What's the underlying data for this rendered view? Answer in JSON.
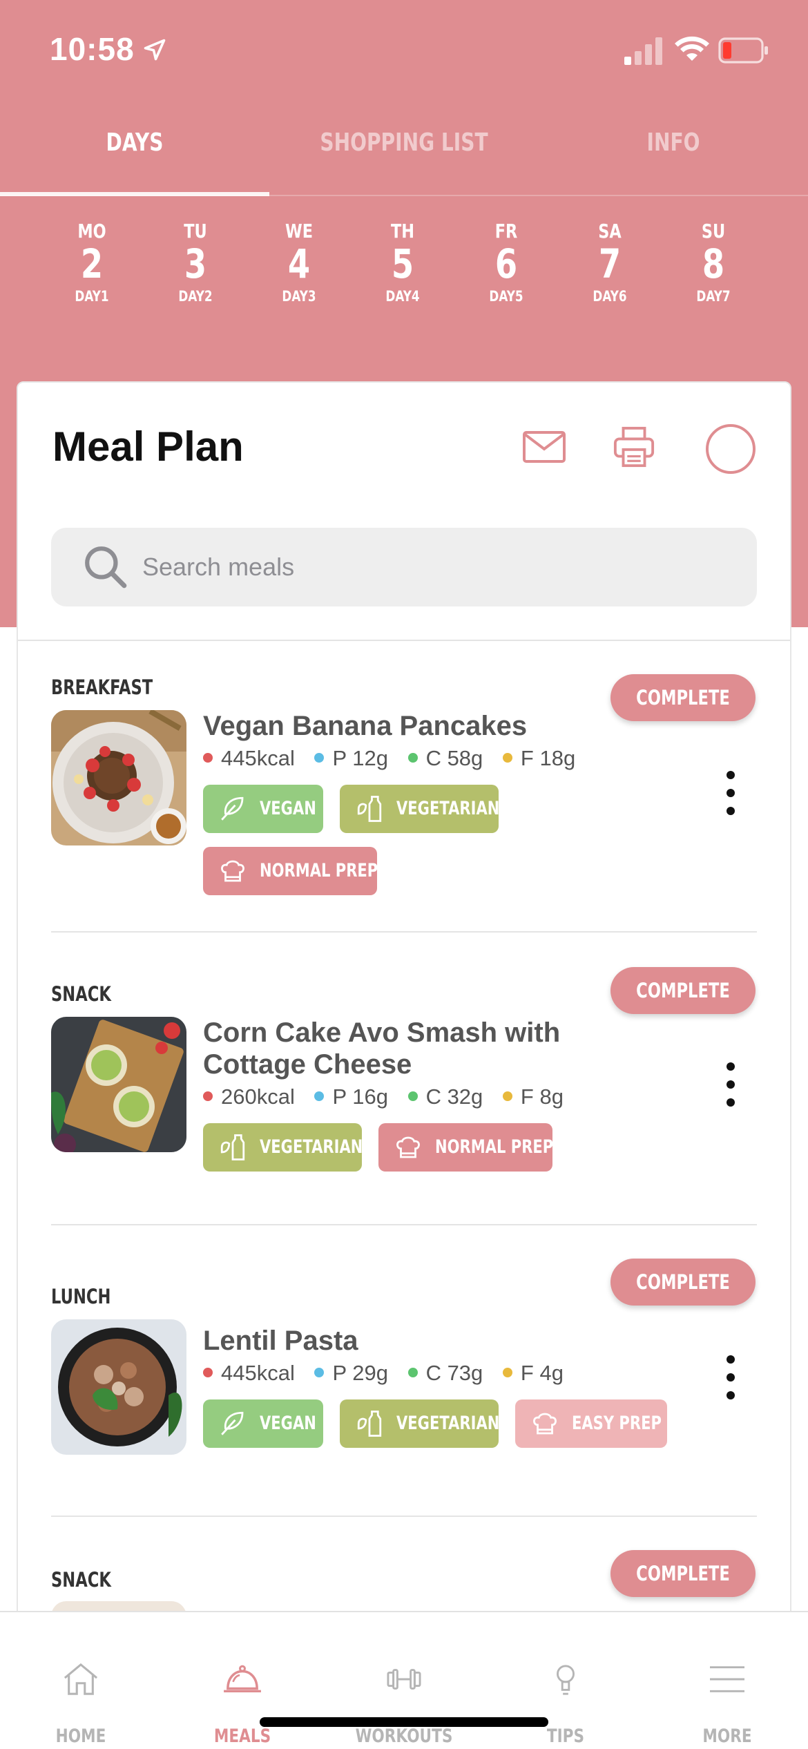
{
  "status_bar": {
    "time": "10:58"
  },
  "tabs": [
    {
      "label": "DAYS",
      "active": true
    },
    {
      "label": "SHOPPING LIST",
      "active": false
    },
    {
      "label": "INFO",
      "active": false
    }
  ],
  "days": [
    {
      "name": "MO",
      "num": "2",
      "label": "DAY1"
    },
    {
      "name": "TU",
      "num": "3",
      "label": "DAY2"
    },
    {
      "name": "WE",
      "num": "4",
      "label": "DAY3"
    },
    {
      "name": "TH",
      "num": "5",
      "label": "DAY4"
    },
    {
      "name": "FR",
      "num": "6",
      "label": "DAY5"
    },
    {
      "name": "SA",
      "num": "7",
      "label": "DAY6"
    },
    {
      "name": "SU",
      "num": "8",
      "label": "DAY7"
    }
  ],
  "meal_plan": {
    "title": "Meal Plan",
    "search_placeholder": "Search meals"
  },
  "meals": [
    {
      "type": "BREAKFAST",
      "complete_label": "COMPLETE",
      "name": "Vegan Banana Pancakes",
      "kcal": "445kcal",
      "protein": "P 12g",
      "carbs": "C 58g",
      "fat": "F 18g",
      "tags": [
        "VEGAN",
        "VEGETARIAN",
        "NORMAL PREP"
      ]
    },
    {
      "type": "SNACK",
      "complete_label": "COMPLETE",
      "name": "Corn Cake Avo Smash with Cottage Cheese",
      "kcal": "260kcal",
      "protein": "P 16g",
      "carbs": "C 32g",
      "fat": "F 8g",
      "tags": [
        "VEGETARIAN",
        "NORMAL PREP"
      ]
    },
    {
      "type": "LUNCH",
      "complete_label": "COMPLETE",
      "name": "Lentil Pasta",
      "kcal": "445kcal",
      "protein": "P 29g",
      "carbs": "C 73g",
      "fat": "F 4g",
      "tags": [
        "VEGAN",
        "VEGETARIAN",
        "EASY PREP"
      ]
    },
    {
      "type": "SNACK",
      "complete_label": "COMPLETE"
    }
  ],
  "macro_colors": {
    "kcal": "#e05a5a",
    "protein": "#5bbce4",
    "carbs": "#5cc46f",
    "fat": "#e8b93c"
  },
  "bottom_nav": [
    {
      "label": "HOME",
      "icon": "home-icon",
      "active": false
    },
    {
      "label": "MEALS",
      "icon": "cloche-icon",
      "active": true
    },
    {
      "label": "WORKOUTS",
      "icon": "dumbbell-icon",
      "active": false
    },
    {
      "label": "TIPS",
      "icon": "lightbulb-icon",
      "active": false
    },
    {
      "label": "MORE",
      "icon": "hamburger-icon",
      "active": false
    }
  ],
  "colors": {
    "brand_pink": "#df8d91",
    "vegan_green": "#95cc80",
    "vegetarian_olive": "#b4bf6b",
    "easy_prep_pink": "#efb4b6"
  }
}
